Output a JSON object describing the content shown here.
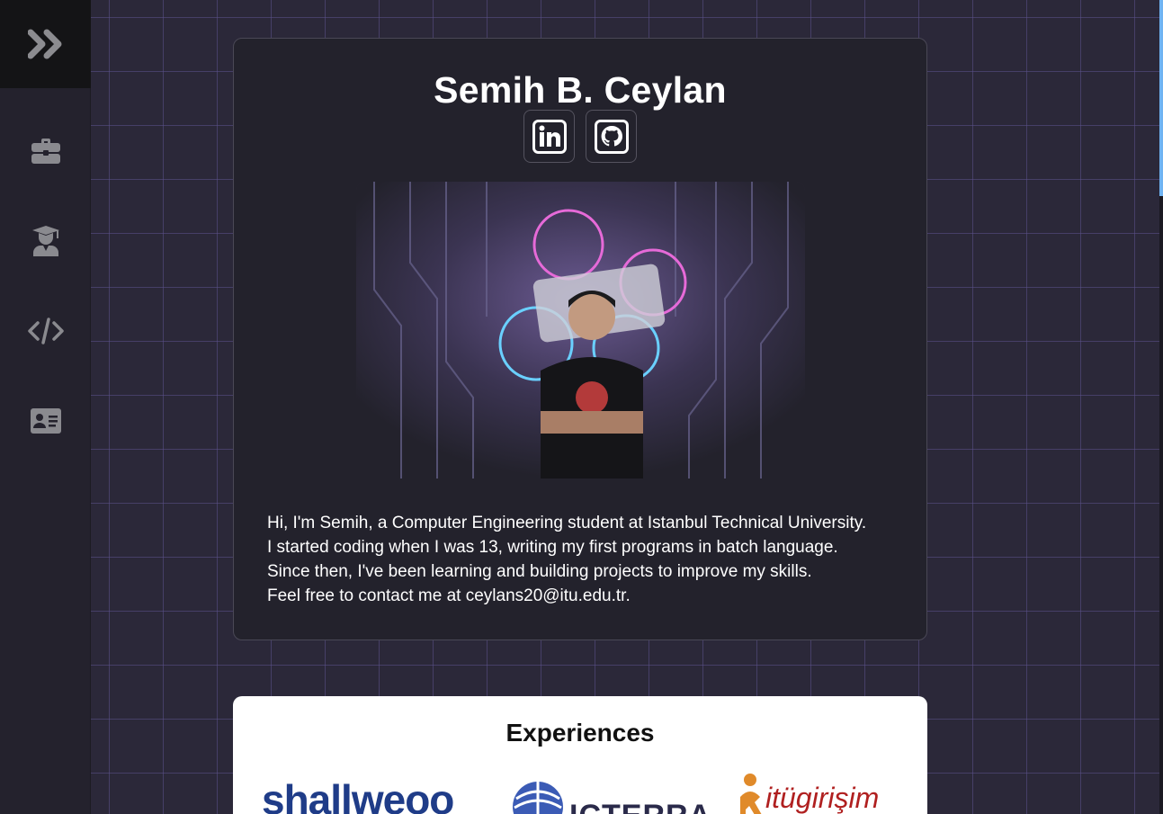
{
  "sidebar": {
    "items": [
      {
        "name": "experience",
        "icon": "briefcase-icon"
      },
      {
        "name": "education",
        "icon": "graduate-icon"
      },
      {
        "name": "projects",
        "icon": "code-icon"
      },
      {
        "name": "contact",
        "icon": "id-card-icon"
      }
    ],
    "toggle_icon": "double-chevron-right-icon"
  },
  "profile": {
    "name": "Semih B. Ceylan",
    "social": [
      {
        "name": "linkedin",
        "icon": "linkedin-icon"
      },
      {
        "name": "github",
        "icon": "github-icon"
      }
    ],
    "photo_alt": "Profile photo",
    "bio_lines": [
      "Hi, I'm Semih, a Computer Engineering student at Istanbul Technical University.",
      "I started coding when I was 13, writing my first programs in batch language.",
      "Since then, I've been learning and building projects to improve my skills.",
      "Feel free to contact me at ceylans20@itu.edu.tr."
    ]
  },
  "experiences": {
    "title": "Experiences",
    "logos": [
      "shallweoo",
      "ICTERRA",
      "itügirişim"
    ]
  },
  "colors": {
    "background": "#2b2839",
    "sidebar": "#24222d",
    "card": "#23222c",
    "accent_scroll": "#6fb3f2",
    "icon_gray": "#8a8a8f"
  }
}
